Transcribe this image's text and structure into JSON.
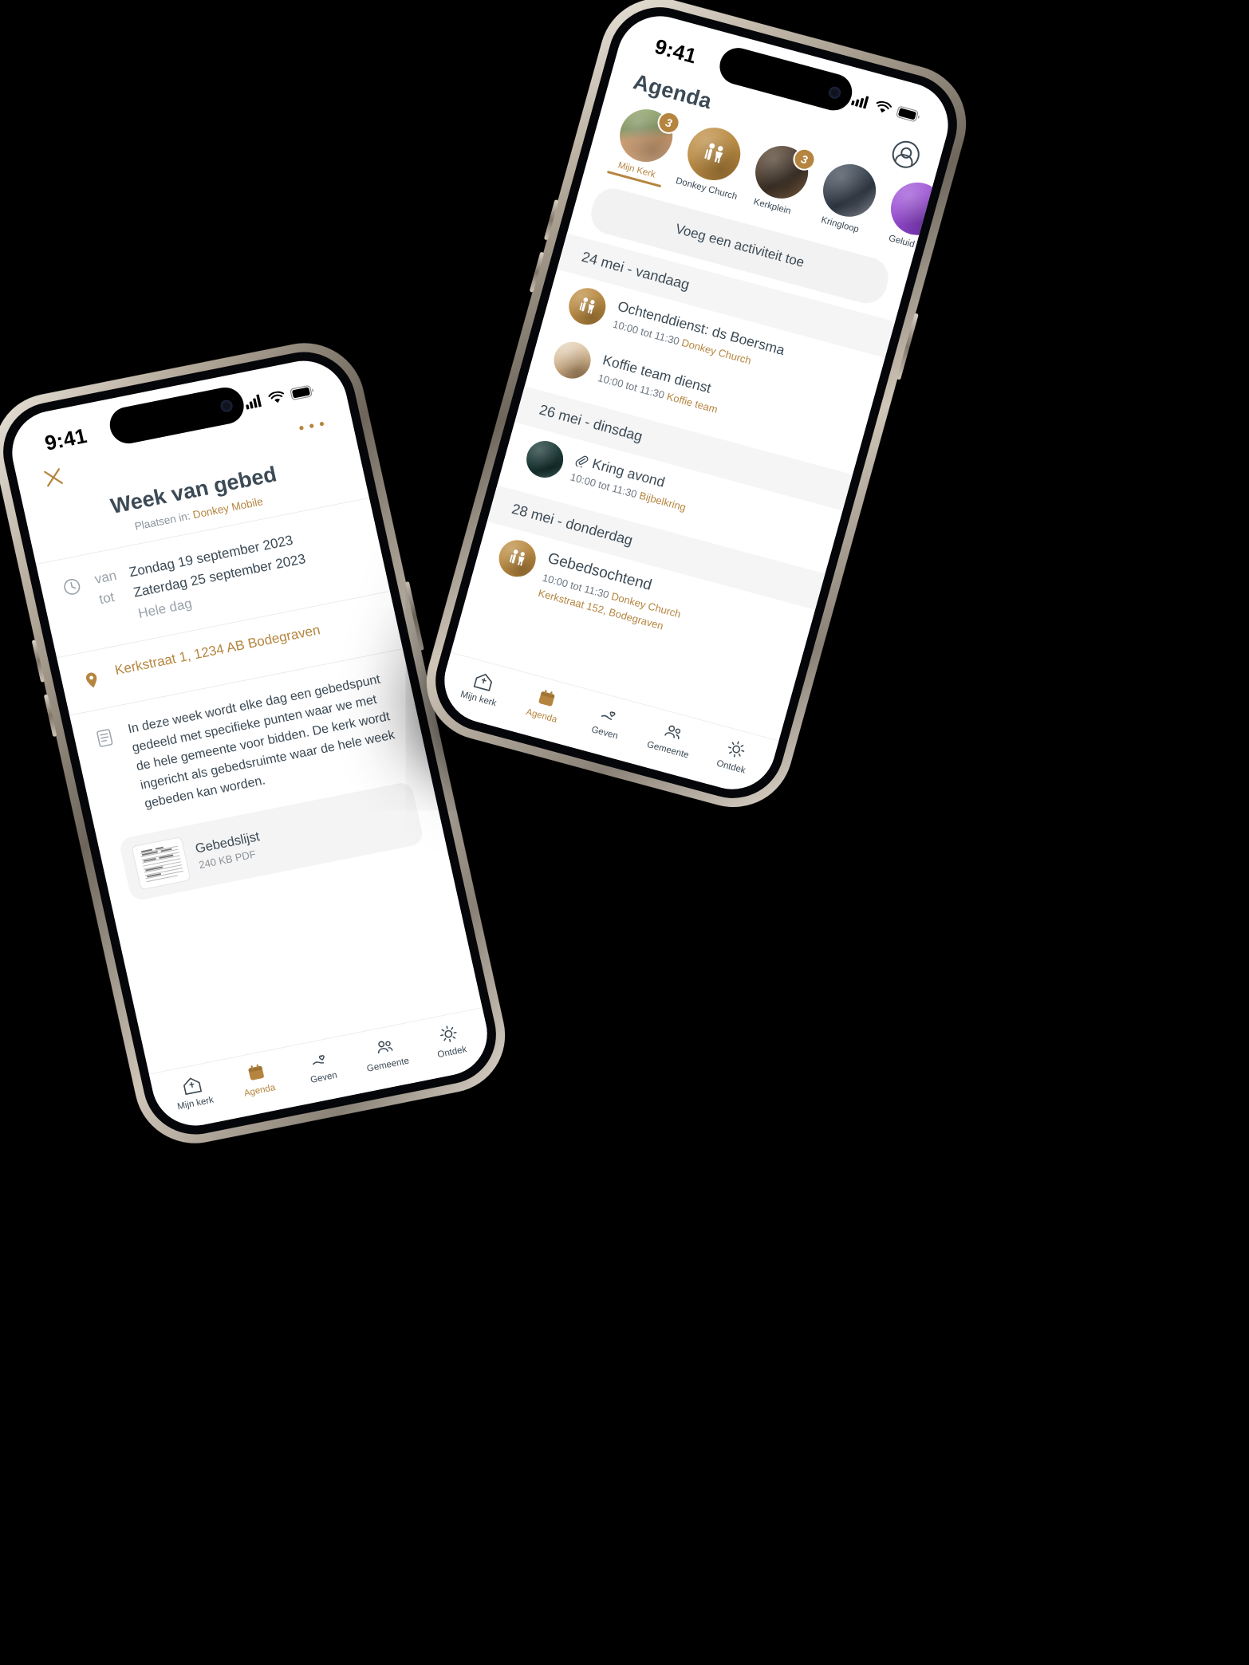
{
  "right_phone": {
    "status": {
      "time": "9:41",
      "cellular": "signal-bars",
      "wifi": "wifi",
      "battery": "battery-full"
    },
    "header": {
      "title": "Agenda",
      "profile_icon": "account-circle-icon"
    },
    "stories": [
      {
        "label": "Mijn Kerk",
        "badge": "3",
        "active": true,
        "art": "img-person"
      },
      {
        "label": "Donkey Church",
        "badge": "",
        "active": false,
        "art": "img-fam"
      },
      {
        "label": "Kerkplein",
        "badge": "3",
        "active": false,
        "art": "img-kerk"
      },
      {
        "label": "Kringloop",
        "badge": "",
        "active": false,
        "art": "img-kring"
      },
      {
        "label": "Geluid en",
        "badge": "",
        "active": false,
        "art": "img-geluid"
      }
    ],
    "add_activity_label": "Voeg een activiteit toe",
    "days": [
      {
        "header": "24 mei - vandaag",
        "events": [
          {
            "title": "Ochtenddienst: ds Boersma",
            "time": "10:00 tot 11:30",
            "group": "Donkey Church",
            "address": "",
            "art": "img-fam",
            "attachment": false
          },
          {
            "title": "Koffie team dienst",
            "time": "10:00 tot 11:30",
            "group": "Koffie team",
            "address": "",
            "art": "img-koffie",
            "attachment": false
          }
        ]
      },
      {
        "header": "26 mei - dinsdag",
        "events": [
          {
            "title": "Kring avond",
            "time": "10:00 tot 11:30",
            "group": "Bijbelkring",
            "address": "",
            "art": "img-bijbel",
            "attachment": true
          }
        ]
      },
      {
        "header": "28 mei - donderdag",
        "events": [
          {
            "title": "Gebedsochtend",
            "time": "10:00 tot 11:30",
            "group": "Donkey Church",
            "address": "Kerkstraat 152, Bodegraven",
            "art": "img-fam",
            "attachment": false
          }
        ]
      }
    ],
    "tabs": [
      {
        "label": "Mijn kerk",
        "icon": "home-church-icon",
        "active": false
      },
      {
        "label": "Agenda",
        "icon": "calendar-icon",
        "active": true
      },
      {
        "label": "Geven",
        "icon": "hand-heart-icon",
        "active": false
      },
      {
        "label": "Gemeente",
        "icon": "people-icon",
        "active": false
      },
      {
        "label": "Ontdek",
        "icon": "sun-icon",
        "active": false
      }
    ]
  },
  "left_phone": {
    "status": {
      "time": "9:41",
      "cellular": "signal-bars",
      "wifi": "wifi",
      "battery": "battery-full"
    },
    "header": {
      "close_icon": "close-icon",
      "more_icon": "more-horizontal-icon"
    },
    "title": "Week van gebed",
    "posted_prefix": "Plaatsen in:",
    "posted_targets": "Donkey  Mobile",
    "datetime": {
      "icon": "clock-icon",
      "from_label": "van",
      "from_value": "Zondag 19 september 2023",
      "to_label": "tot",
      "to_value": "Zaterdag 25 september 2023",
      "all_day": "Hele dag"
    },
    "location": {
      "icon": "map-pin-icon",
      "text": "Kerkstraat 1, 1234 AB Bodegraven"
    },
    "description": {
      "icon": "document-icon",
      "text": "In deze week wordt elke dag een gebedspunt gedeeld met specifieke punten waar we met de hele gemeente voor bidden. De kerk wordt ingericht als gebedsruimte waar de hele week gebeden kan worden."
    },
    "attachment": {
      "name": "Gebedslijst",
      "size": "240 KB PDF",
      "icon": "pdf-thumbnail"
    },
    "tabs": [
      {
        "label": "Mijn kerk",
        "icon": "home-church-icon",
        "active": false
      },
      {
        "label": "Agenda",
        "icon": "calendar-icon",
        "active": true
      },
      {
        "label": "Geven",
        "icon": "hand-heart-icon",
        "active": false
      },
      {
        "label": "Gemeente",
        "icon": "people-icon",
        "active": false
      },
      {
        "label": "Ontdek",
        "icon": "sun-icon",
        "active": false
      }
    ]
  },
  "theme": {
    "accent": "#b5853f",
    "text": "#3c4a55",
    "muted": "#8b939b",
    "background": "#000000"
  }
}
